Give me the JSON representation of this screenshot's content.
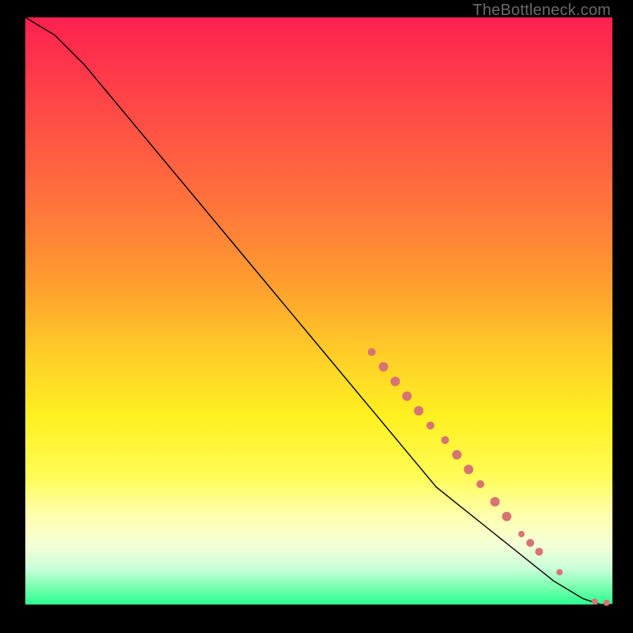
{
  "attribution": "TheBottleneck.com",
  "chart_data": {
    "type": "line",
    "title": "",
    "xlabel": "",
    "ylabel": "",
    "xlim": [
      0,
      100
    ],
    "ylim": [
      0,
      100
    ],
    "curve": [
      {
        "x": 0,
        "y": 100
      },
      {
        "x": 5,
        "y": 97
      },
      {
        "x": 10,
        "y": 92
      },
      {
        "x": 20,
        "y": 80
      },
      {
        "x": 30,
        "y": 68
      },
      {
        "x": 40,
        "y": 56
      },
      {
        "x": 50,
        "y": 44
      },
      {
        "x": 60,
        "y": 32
      },
      {
        "x": 70,
        "y": 20
      },
      {
        "x": 80,
        "y": 12
      },
      {
        "x": 90,
        "y": 4
      },
      {
        "x": 95,
        "y": 1
      },
      {
        "x": 98,
        "y": 0
      },
      {
        "x": 100,
        "y": 0
      }
    ],
    "markers": [
      {
        "x": 59,
        "y": 43,
        "r": 5
      },
      {
        "x": 61,
        "y": 40.5,
        "r": 6
      },
      {
        "x": 63,
        "y": 38,
        "r": 6
      },
      {
        "x": 65,
        "y": 35.5,
        "r": 6
      },
      {
        "x": 67,
        "y": 33,
        "r": 6
      },
      {
        "x": 69,
        "y": 30.5,
        "r": 5
      },
      {
        "x": 71.5,
        "y": 28,
        "r": 5
      },
      {
        "x": 73.5,
        "y": 25.5,
        "r": 6
      },
      {
        "x": 75.5,
        "y": 23,
        "r": 6
      },
      {
        "x": 77.5,
        "y": 20.5,
        "r": 5
      },
      {
        "x": 80,
        "y": 17.5,
        "r": 6
      },
      {
        "x": 82,
        "y": 15,
        "r": 6
      },
      {
        "x": 84.5,
        "y": 12,
        "r": 4
      },
      {
        "x": 86,
        "y": 10.5,
        "r": 5
      },
      {
        "x": 87.5,
        "y": 9,
        "r": 5
      },
      {
        "x": 91,
        "y": 5.5,
        "r": 4
      },
      {
        "x": 97,
        "y": 0.5,
        "r": 4
      },
      {
        "x": 99,
        "y": 0.3,
        "r": 4
      }
    ],
    "gradient_stops": [
      {
        "pos": 0,
        "color": "#ff2050"
      },
      {
        "pos": 68,
        "color": "#fff020"
      },
      {
        "pos": 100,
        "color": "#2aff90"
      }
    ]
  }
}
